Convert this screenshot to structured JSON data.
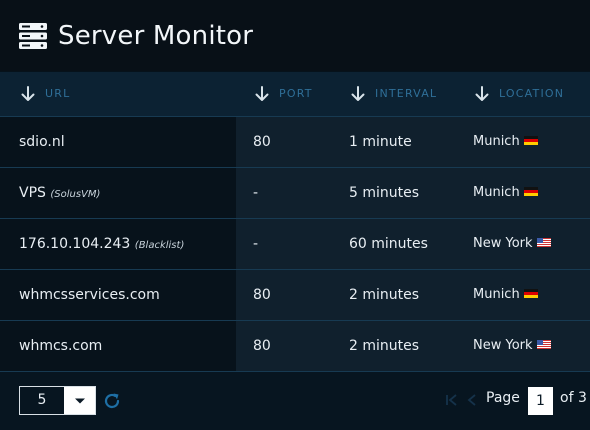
{
  "app": {
    "title": "Server Monitor",
    "icon": "server-stack-icon"
  },
  "table": {
    "columns": [
      {
        "label": "URL",
        "sort": "desc"
      },
      {
        "label": "PORT",
        "sort": "desc"
      },
      {
        "label": "INTERVAL",
        "sort": "desc"
      },
      {
        "label": "LOCATION",
        "sort": "desc"
      }
    ],
    "rows": [
      {
        "url": "sdio.nl",
        "note": "",
        "port": "80",
        "interval": "1 minute",
        "location": "Munich",
        "flag": "de"
      },
      {
        "url": "VPS",
        "note": "(SolusVM)",
        "port": "-",
        "interval": "5 minutes",
        "location": "Munich",
        "flag": "de"
      },
      {
        "url": "176.10.104.243",
        "note": "(Blacklist)",
        "port": "-",
        "interval": "60 minutes",
        "location": "New York",
        "flag": "us"
      },
      {
        "url": "whmcsservices.com",
        "note": "",
        "port": "80",
        "interval": "2 minutes",
        "location": "Munich",
        "flag": "de"
      },
      {
        "url": "whmcs.com",
        "note": "",
        "port": "80",
        "interval": "2 minutes",
        "location": "New York",
        "flag": "us"
      }
    ]
  },
  "footer": {
    "page_size": "5",
    "page_label": "Page",
    "current_page": "1",
    "of_label": "of 3"
  },
  "colors": {
    "header_bg": "#081017",
    "column_header_text": "#2f6f98",
    "accent": "#1e6fa5"
  }
}
